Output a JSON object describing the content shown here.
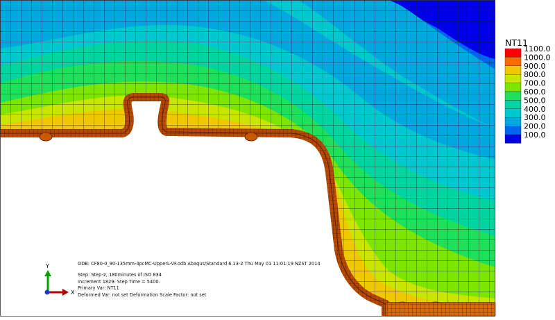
{
  "legend": {
    "title": "NT11",
    "labels": [
      "1100.0",
      "1000.0",
      "900.0",
      "800.0",
      "700.0",
      "600.0",
      "500.0",
      "400.0",
      "300.0",
      "200.0",
      "100.0"
    ],
    "colors": [
      "#ff0000",
      "#ff6a00",
      "#f0c800",
      "#c8e600",
      "#7ce600",
      "#1fe05a",
      "#00d4a0",
      "#00c8d0",
      "#00a8e0",
      "#0066f0",
      "#0000e6"
    ]
  },
  "triad": {
    "y_axis": "Y",
    "x_axis": "X",
    "z_axis": "Z"
  },
  "info": {
    "odb": "ODB: CF80-0_90-135mm-4pcMC-UpperL-VF.odb    Abaqus/Standard 6.13-2    Thu May 01 11:01:19 NZST 2014",
    "step": "Step: Step-2, 180minutes of ISO 834",
    "increment": "Increment    1829: Step Time =       5400.",
    "primary_var": "Primary Var: NT11",
    "deformed_var": "Deformed Var: not set   Deformation Scale Factor: not set"
  }
}
